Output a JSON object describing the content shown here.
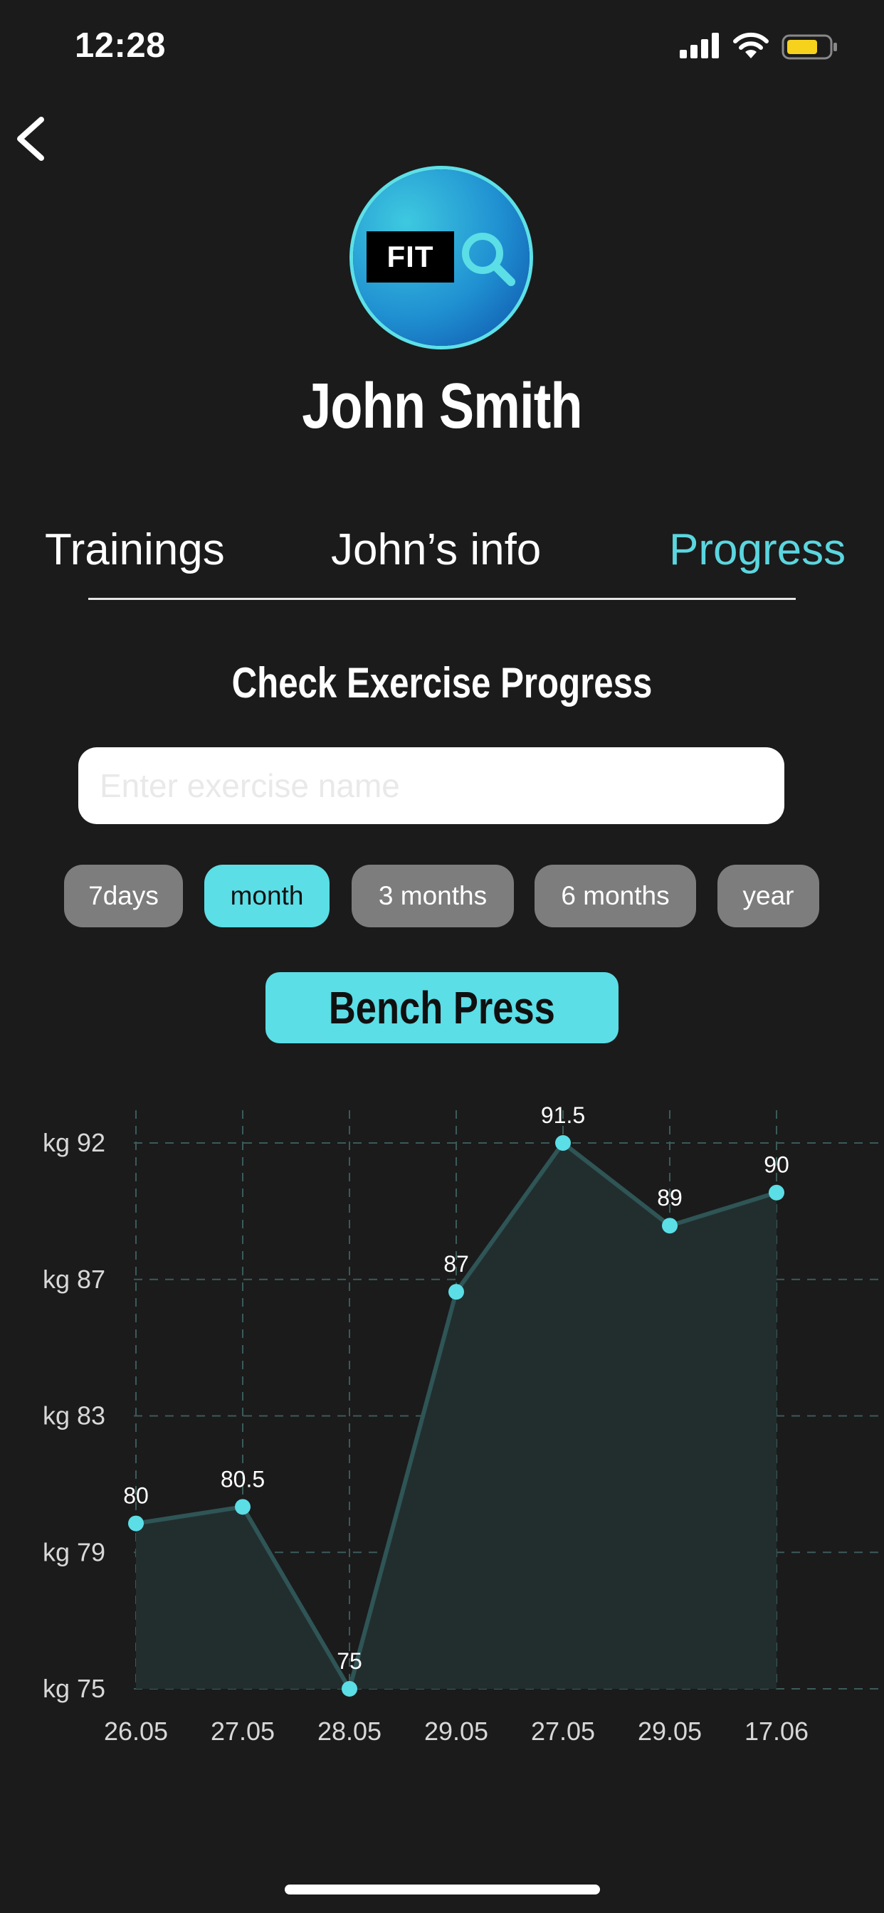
{
  "status_bar": {
    "time": "12:28",
    "battery_color": "#f6d21c"
  },
  "header": {
    "back_icon": "chevron-left-icon"
  },
  "logo": {
    "text": "FIT",
    "icon": "magnifier-icon"
  },
  "user": {
    "name": "John Smith"
  },
  "tabs": [
    {
      "label": "Trainings",
      "active": false
    },
    {
      "label": "John’s info",
      "active": false
    },
    {
      "label": "Progress",
      "active": true
    }
  ],
  "progress": {
    "heading": "Check Exercise Progress",
    "search_placeholder": "Enter exercise name",
    "search_value": "",
    "filters": [
      {
        "label": "7days",
        "active": false
      },
      {
        "label": "month",
        "active": true
      },
      {
        "label": "3 months",
        "active": false
      },
      {
        "label": "6 months",
        "active": false
      },
      {
        "label": "year",
        "active": false
      }
    ],
    "exercise_label": "Bench Press"
  },
  "colors": {
    "accent": "#5bdee6",
    "background": "#1b1b1b",
    "pill": "#7d7d7d"
  },
  "chart_data": {
    "type": "area",
    "categories": [
      "26.05",
      "27.05",
      "28.05",
      "29.05",
      "27.05",
      "29.05",
      "17.06"
    ],
    "values": [
      80,
      80.5,
      75,
      87,
      91.5,
      89,
      90
    ],
    "data_labels": [
      "80",
      "80.5",
      "75",
      "87",
      "91.5",
      "89",
      "90"
    ],
    "y_ticks": [
      "kg 75",
      "kg 79",
      "kg 83",
      "kg 87",
      "kg 92"
    ],
    "ylim": [
      75,
      91.5
    ],
    "grid": true,
    "legend": "none"
  }
}
